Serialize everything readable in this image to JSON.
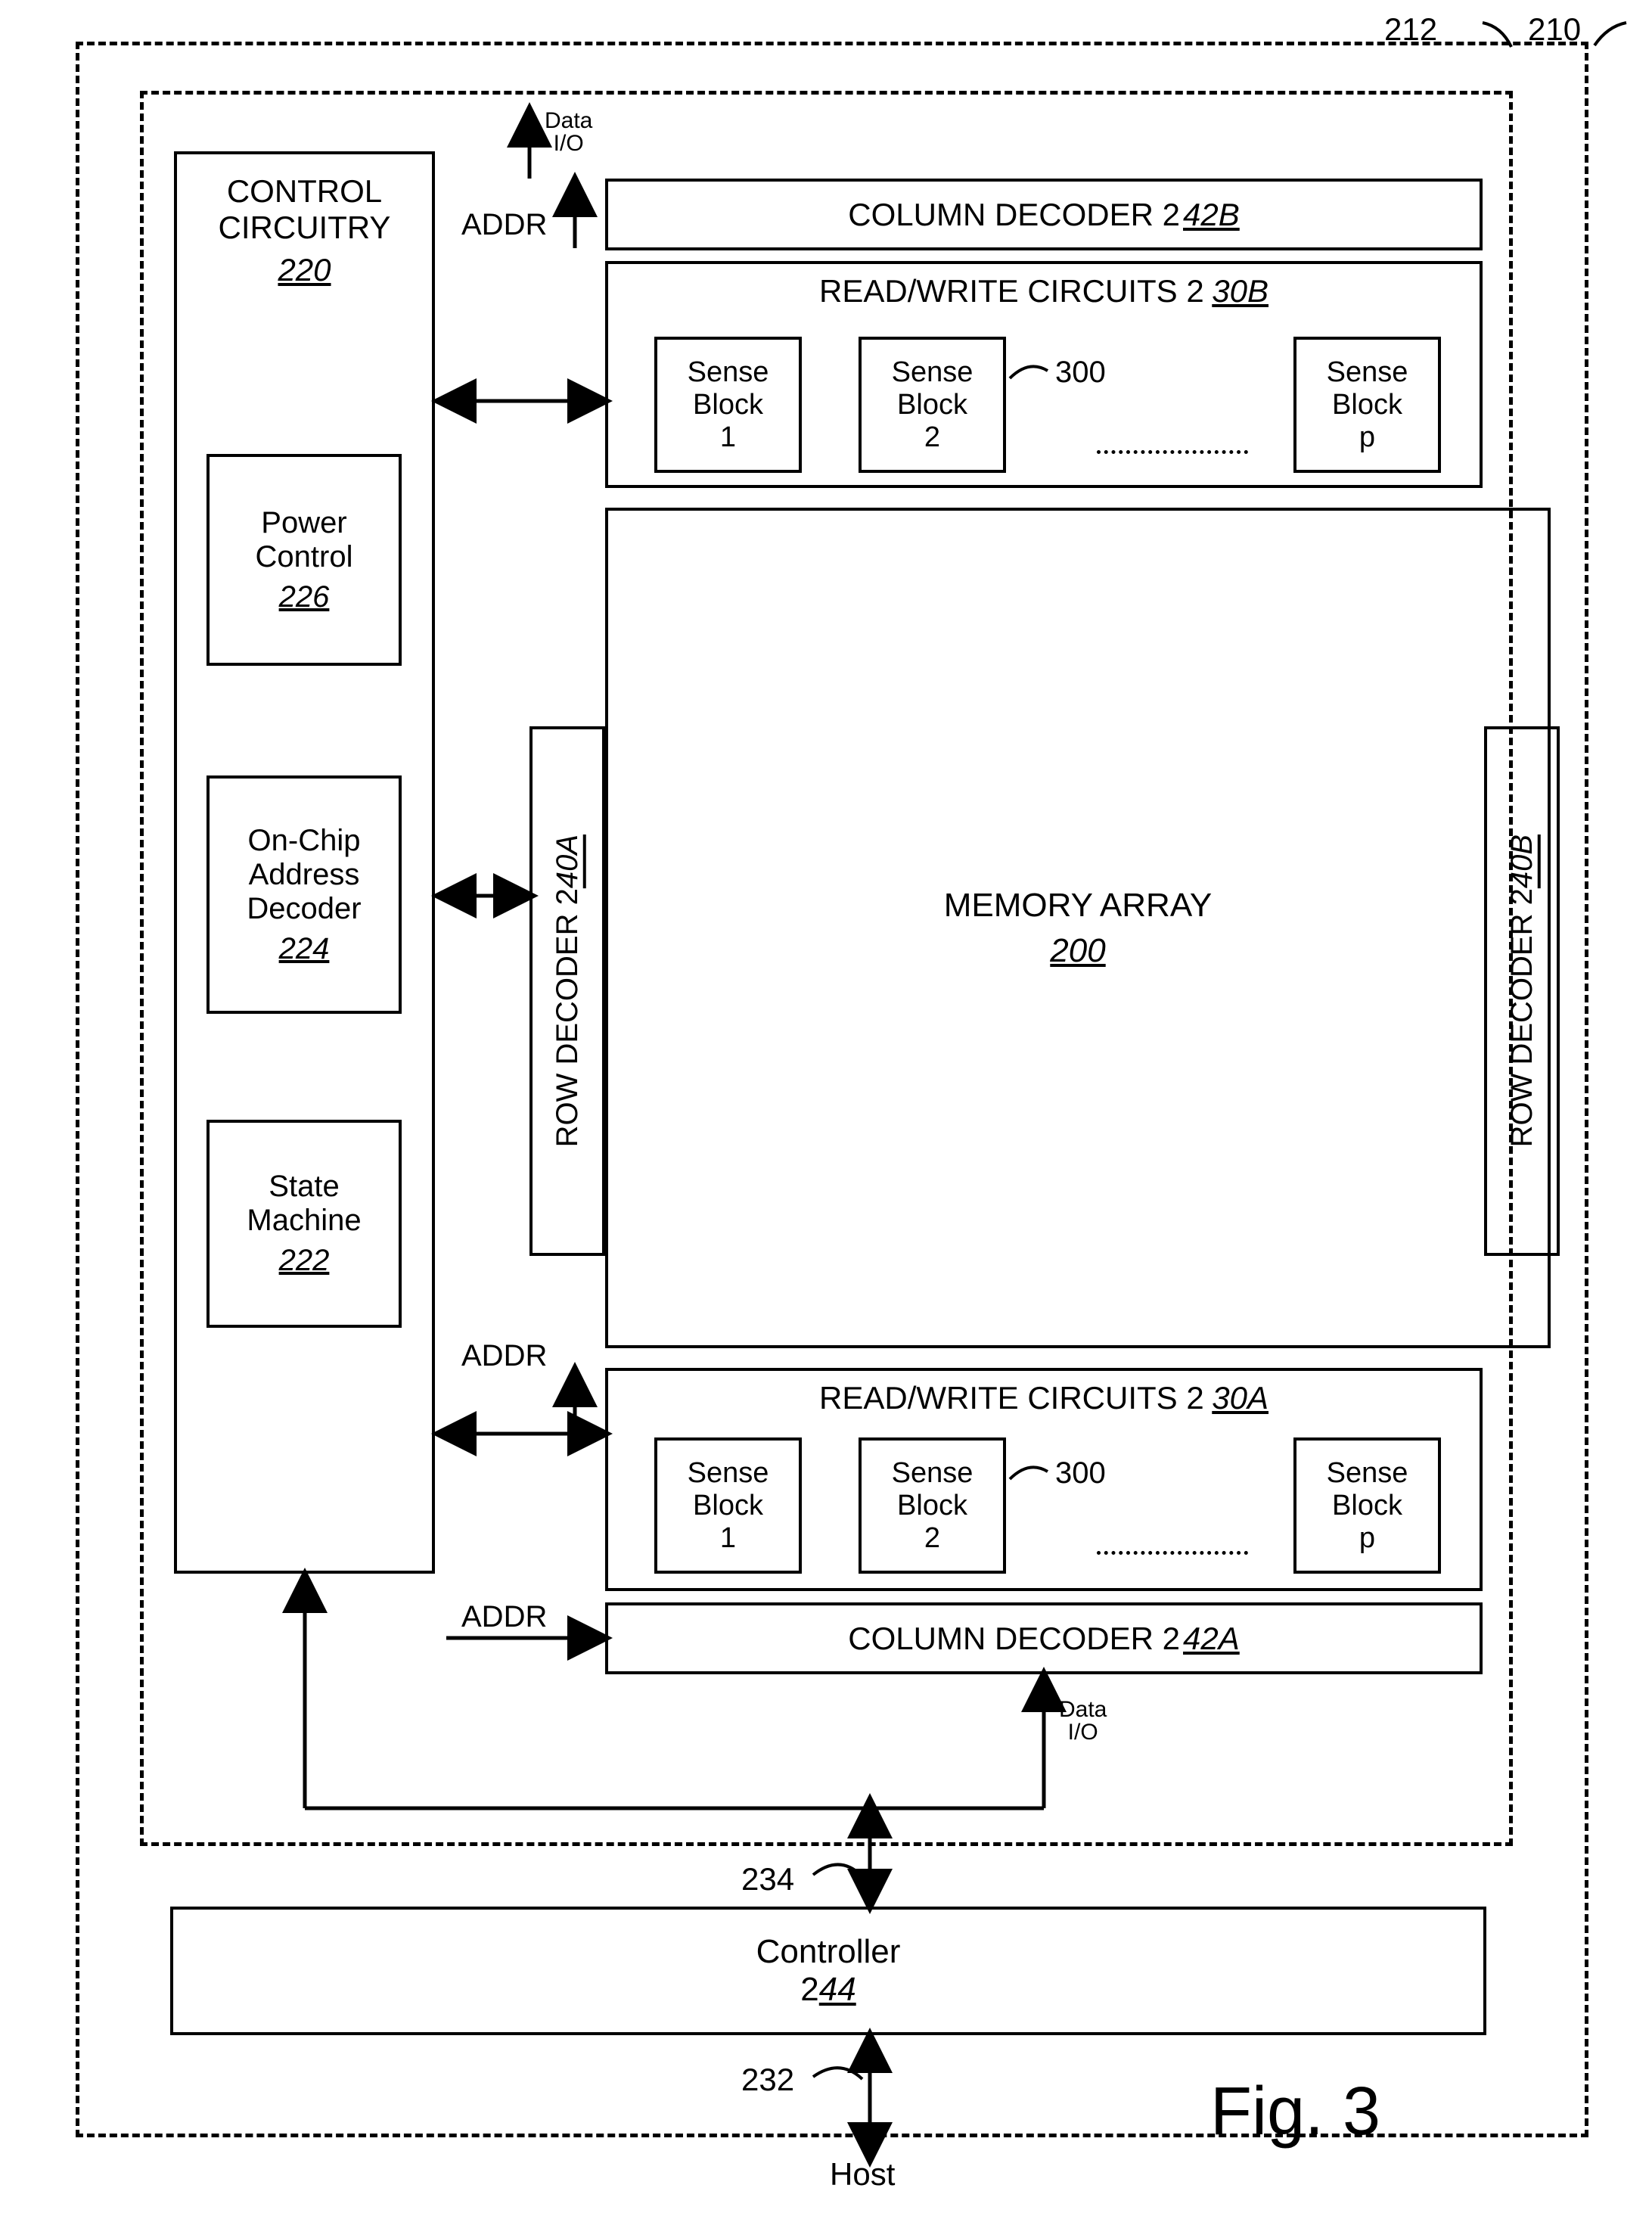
{
  "refs": {
    "outer": "210",
    "inner": "212",
    "ctrl_title": "CONTROL CIRCUITRY",
    "ctrl_ref": "220",
    "power": "Power Control",
    "power_ref": "226",
    "addrDec": "On-Chip Address Decoder",
    "addrDec_ref": "224",
    "state": "State Machine",
    "state_ref": "222",
    "colDecB": "COLUMN DECODER 2",
    "colDecB_ref": "42B",
    "rwB": "READ/WRITE CIRCUITS 2",
    "rwB_ref": "30B",
    "rowA": "ROW DECODER 2",
    "rowA_ref": "40A",
    "rowB": "ROW DECODER 2",
    "rowB_ref": "40B",
    "memArray": "MEMORY ARRAY",
    "memArray_ref": "200",
    "rwA": "READ/WRITE CIRCUITS 2",
    "rwA_ref": "30A",
    "colDecA": "COLUMN DECODER 2",
    "colDecA_ref": "42A",
    "sense": "Sense Block",
    "sense1": "1",
    "sense2": "2",
    "sensep": "p",
    "senseRef": "300",
    "controller": "Controller",
    "controller_ref": "44",
    "controller_prefix": "2",
    "host": "Host",
    "hostRef": "232",
    "ctrlLineRef": "234",
    "addr": "ADDR",
    "dataIO": "Data I/O",
    "figTitle": "Fig. 3"
  }
}
